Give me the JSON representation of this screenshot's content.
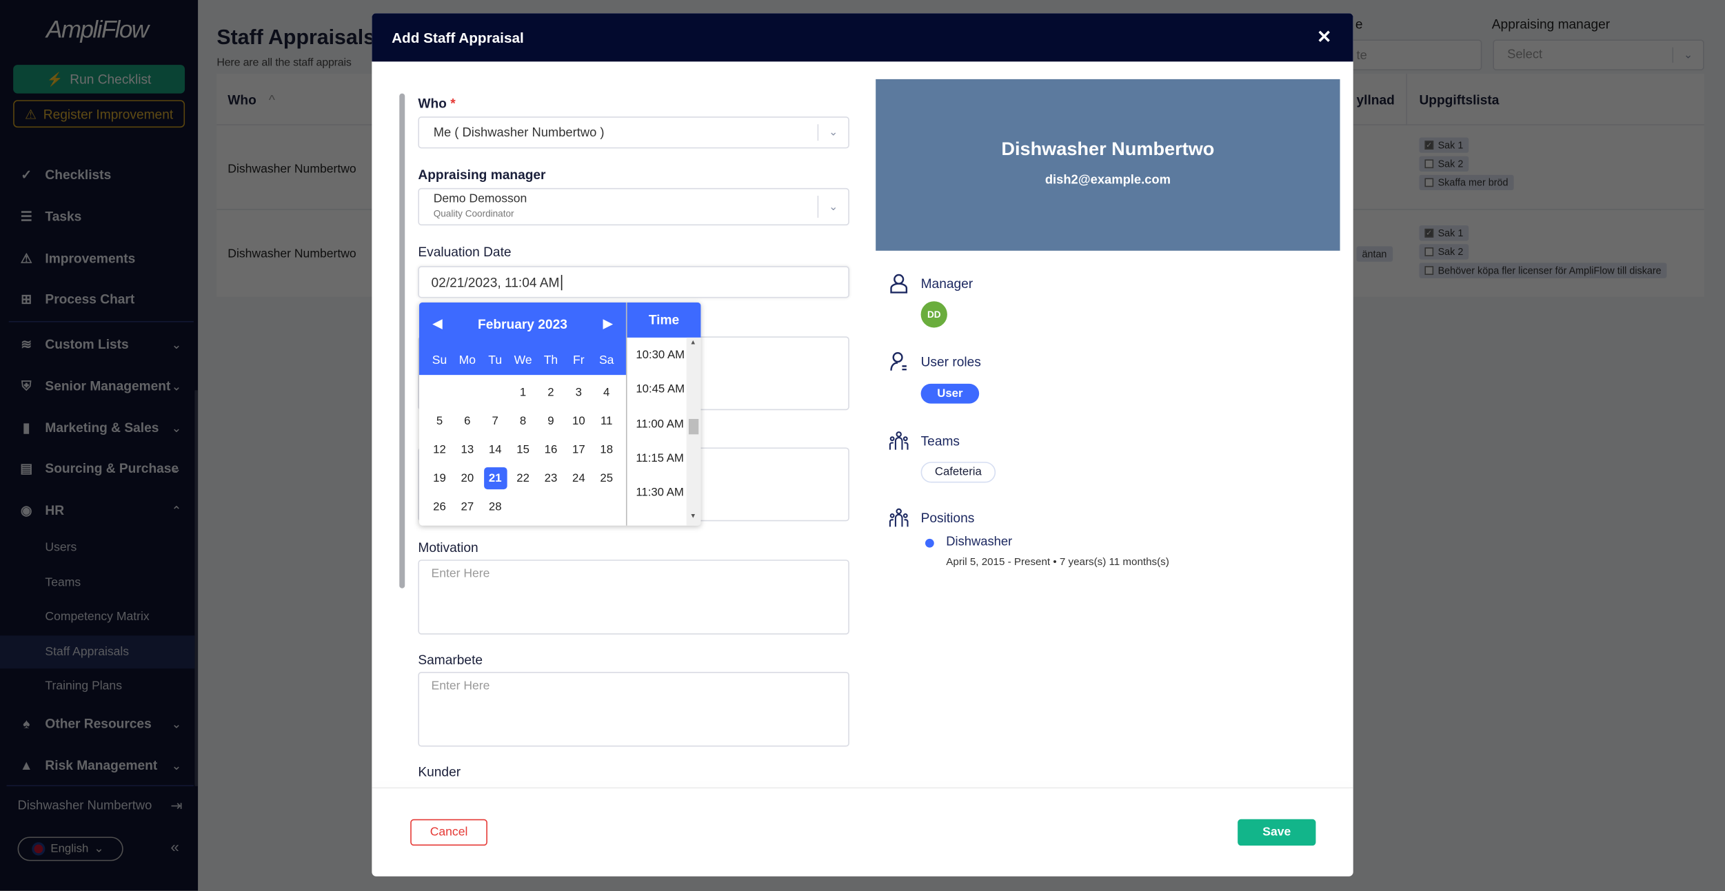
{
  "sidebar": {
    "logo": "AmpliFlow",
    "run_checklist": "Run Checklist",
    "register_improvement": "Register Improvement",
    "items": [
      {
        "label": "Checklists",
        "icon": "check-icon"
      },
      {
        "label": "Tasks",
        "icon": "task-list-icon"
      },
      {
        "label": "Improvements",
        "icon": "warning-icon"
      },
      {
        "label": "Process Chart",
        "icon": "process-chart-icon"
      },
      {
        "label": "Custom Lists",
        "icon": "layers-icon"
      },
      {
        "label": "Senior Management",
        "icon": "shield-icon"
      },
      {
        "label": "Marketing & Sales",
        "icon": "megaphone-icon"
      },
      {
        "label": "Sourcing & Purchase",
        "icon": "document-icon"
      },
      {
        "label": "HR",
        "icon": "people-icon"
      },
      {
        "label": "Other Resources",
        "icon": "parachute-icon"
      },
      {
        "label": "Risk Management",
        "icon": "alarm-icon"
      }
    ],
    "hr_sub": [
      "Users",
      "Teams",
      "Competency Matrix",
      "Staff Appraisals",
      "Training Plans"
    ],
    "user": "Dishwasher Numbertwo",
    "language": "English"
  },
  "page": {
    "title": "Staff Appraisals",
    "subtitle": "Here are all the staff apprais",
    "filter_date_label": "e",
    "filter_date_placeholder": "te",
    "filter_manager_label": "Appraising manager",
    "filter_manager_placeholder": "Select",
    "columns": [
      "Who",
      "yllnad",
      "Uppgiftslista"
    ],
    "rows": [
      {
        "who": "Dishwasher Numbertwo",
        "partial": "",
        "tasks": [
          {
            "label": "Sak 1",
            "checked": true
          },
          {
            "label": "Sak 2",
            "checked": false
          },
          {
            "label": "Skaffa mer bröd",
            "checked": false
          }
        ]
      },
      {
        "who": "Dishwasher Numbertwo",
        "partial": "äntan",
        "tasks": [
          {
            "label": "Sak 1",
            "checked": true
          },
          {
            "label": "Sak 2",
            "checked": false
          },
          {
            "label": "Behöver köpa fler licenser för AmpliFlow till diskare",
            "checked": false
          }
        ]
      }
    ]
  },
  "modal": {
    "title": "Add Staff Appraisal",
    "close": "✕",
    "who_label": "Who",
    "required": "*",
    "who_value": "Me ( Dishwasher Numbertwo )",
    "manager_label": "Appraising manager",
    "manager_name": "Demo Demosson",
    "manager_role": "Quality Coordinator",
    "date_label": "Evaluation Date",
    "date_value": "02/21/2023, 11:04 AM",
    "motivation_label": "Motivation",
    "samarbete_label": "Samarbete",
    "kunder_label": "Kunder",
    "placeholder": "Enter Here",
    "cancel": "Cancel",
    "save": "Save",
    "calendar": {
      "month": "February 2023",
      "weekdays": [
        "Su",
        "Mo",
        "Tu",
        "We",
        "Th",
        "Fr",
        "Sa"
      ],
      "selected_day": 21,
      "time_label": "Time",
      "times": [
        "10:30 AM",
        "10:45 AM",
        "11:00 AM",
        "11:15 AM",
        "11:30 AM"
      ]
    },
    "profile": {
      "name": "Dishwasher Numbertwo",
      "email": "dish2@example.com",
      "manager_label": "Manager",
      "manager_initials": "DD",
      "roles_label": "User roles",
      "role": "User",
      "teams_label": "Teams",
      "team": "Cafeteria",
      "positions_label": "Positions",
      "position": "Dishwasher",
      "position_period": "April 5, 2015 - Present • 7 years(s) 11 months(s)"
    }
  },
  "colors": {
    "accent": "#3d6aff",
    "save": "#12b58a",
    "cancel": "#e53935",
    "header": "#030a2e",
    "card": "#5c7a9e",
    "avatar": "#6aad3d"
  }
}
